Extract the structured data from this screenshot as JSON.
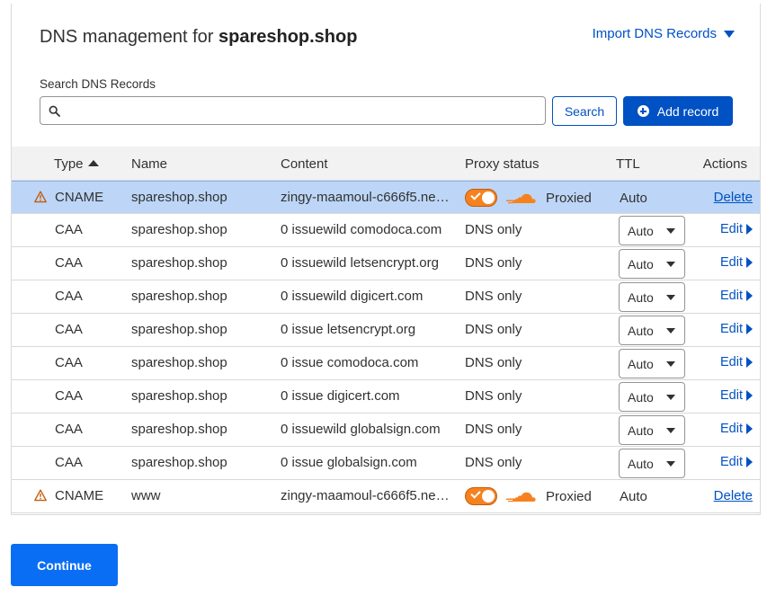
{
  "header": {
    "title_prefix": "DNS management for ",
    "domain": "spareshop.shop",
    "import_label": "Import DNS Records"
  },
  "search": {
    "label": "Search DNS Records",
    "value": "",
    "placeholder": "",
    "button_label": "Search"
  },
  "add_record_label": "Add record",
  "table": {
    "columns": [
      "Type",
      "Name",
      "Content",
      "Proxy status",
      "TTL",
      "Actions"
    ],
    "rows": [
      {
        "warn": true,
        "type": "CNAME",
        "name": "spareshop.shop",
        "content": "zingy-maamoul-c666f5.ne…",
        "proxy": "Proxied",
        "ttl": "Auto",
        "action": "Delete"
      },
      {
        "warn": false,
        "type": "CAA",
        "name": "spareshop.shop",
        "content": "0 issuewild comodoca.com",
        "proxy": "DNS only",
        "ttl": "Auto",
        "action": "Edit"
      },
      {
        "warn": false,
        "type": "CAA",
        "name": "spareshop.shop",
        "content": "0 issuewild letsencrypt.org",
        "proxy": "DNS only",
        "ttl": "Auto",
        "action": "Edit"
      },
      {
        "warn": false,
        "type": "CAA",
        "name": "spareshop.shop",
        "content": "0 issuewild digicert.com",
        "proxy": "DNS only",
        "ttl": "Auto",
        "action": "Edit"
      },
      {
        "warn": false,
        "type": "CAA",
        "name": "spareshop.shop",
        "content": "0 issue letsencrypt.org",
        "proxy": "DNS only",
        "ttl": "Auto",
        "action": "Edit"
      },
      {
        "warn": false,
        "type": "CAA",
        "name": "spareshop.shop",
        "content": "0 issue comodoca.com",
        "proxy": "DNS only",
        "ttl": "Auto",
        "action": "Edit"
      },
      {
        "warn": false,
        "type": "CAA",
        "name": "spareshop.shop",
        "content": "0 issue digicert.com",
        "proxy": "DNS only",
        "ttl": "Auto",
        "action": "Edit"
      },
      {
        "warn": false,
        "type": "CAA",
        "name": "spareshop.shop",
        "content": "0 issuewild globalsign.com",
        "proxy": "DNS only",
        "ttl": "Auto",
        "action": "Edit"
      },
      {
        "warn": false,
        "type": "CAA",
        "name": "spareshop.shop",
        "content": "0 issue globalsign.com",
        "proxy": "DNS only",
        "ttl": "Auto",
        "action": "Edit"
      },
      {
        "warn": true,
        "type": "CNAME",
        "name": "www",
        "content": "zingy-maamoul-c666f5.ne…",
        "proxy": "Proxied",
        "ttl": "Auto",
        "action": "Delete"
      }
    ]
  },
  "continue_label": "Continue",
  "colors": {
    "accent": "#0051c3",
    "continue": "#0a6ef5",
    "proxied_orange": "#f6821f",
    "highlight_row": "#bdd6f7"
  },
  "icons": {
    "search": "search-icon",
    "add": "plus-circle-icon",
    "warning": "warning-icon",
    "cloud": "cloud-icon",
    "toggle": "toggle-on-icon"
  }
}
